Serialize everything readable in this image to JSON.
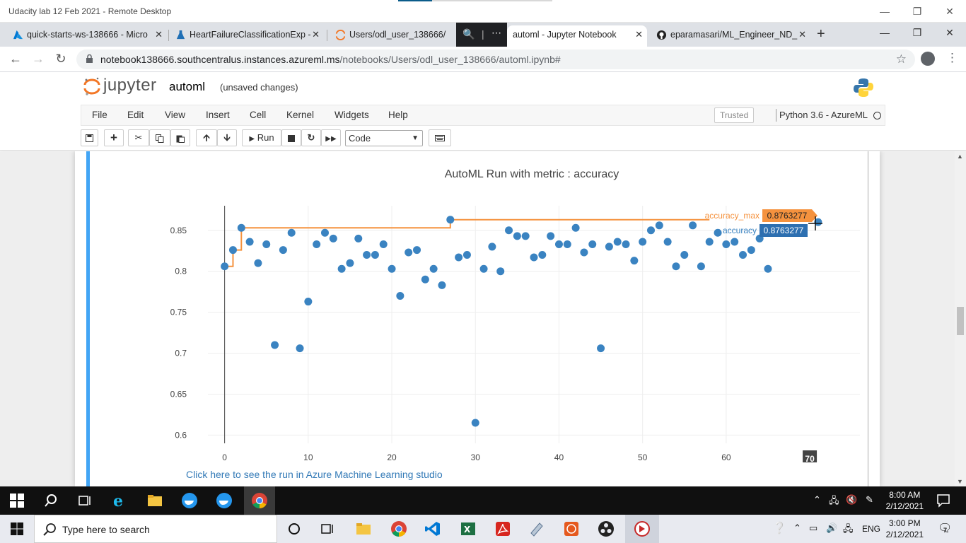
{
  "remote_window": {
    "title": "Udacity lab 12 Feb 2021 - Remote Desktop"
  },
  "browser": {
    "tabs": [
      {
        "label": "quick-starts-ws-138666 - Micro"
      },
      {
        "label": "HeartFailureClassificationExp -"
      },
      {
        "label": "Users/odl_user_138666/"
      },
      {
        "label": "automl - Jupyter Notebook"
      },
      {
        "label": "eparamasari/ML_Engineer_ND_"
      }
    ],
    "url_host": "notebook138666.southcentralus.instances.azureml.ms",
    "url_path": "/notebooks/Users/odl_user_138666/automl.ipynb#"
  },
  "jupyter": {
    "logo_text": "jupyter",
    "notebook_name": "automl",
    "save_status": "(unsaved changes)",
    "menu": [
      "File",
      "Edit",
      "View",
      "Insert",
      "Cell",
      "Kernel",
      "Widgets",
      "Help"
    ],
    "trusted": "Trusted",
    "kernel": "Python 3.6 - AzureML",
    "run_label": "Run",
    "cell_type": "Code",
    "link_text": "Click here to see the run in Azure Machine Learning studio"
  },
  "chart_data": {
    "type": "scatter",
    "title": "AutoML Run with metric : accuracy",
    "xlabel": "",
    "ylabel": "",
    "x_ticks": [
      0,
      10,
      20,
      30,
      40,
      50,
      60
    ],
    "y_ticks": [
      0.6,
      0.65,
      0.7,
      0.75,
      0.8,
      0.85
    ],
    "xlim": [
      -2,
      76
    ],
    "ylim": [
      0.59,
      0.88
    ],
    "grid": true,
    "series": [
      {
        "name": "accuracy",
        "color": "#3a83c1",
        "points": [
          [
            0,
            0.806
          ],
          [
            1,
            0.826
          ],
          [
            2,
            0.853
          ],
          [
            3,
            0.836
          ],
          [
            4,
            0.81
          ],
          [
            5,
            0.833
          ],
          [
            6,
            0.71
          ],
          [
            7,
            0.826
          ],
          [
            8,
            0.847
          ],
          [
            9,
            0.706
          ],
          [
            10,
            0.763
          ],
          [
            11,
            0.833
          ],
          [
            12,
            0.847
          ],
          [
            13,
            0.84
          ],
          [
            14,
            0.803
          ],
          [
            15,
            0.81
          ],
          [
            16,
            0.84
          ],
          [
            17,
            0.82
          ],
          [
            18,
            0.82
          ],
          [
            19,
            0.833
          ],
          [
            20,
            0.803
          ],
          [
            21,
            0.77
          ],
          [
            22,
            0.823
          ],
          [
            23,
            0.826
          ],
          [
            24,
            0.79
          ],
          [
            25,
            0.803
          ],
          [
            26,
            0.783
          ],
          [
            27,
            0.863
          ],
          [
            28,
            0.817
          ],
          [
            29,
            0.82
          ],
          [
            30,
            0.615
          ],
          [
            31,
            0.803
          ],
          [
            32,
            0.83
          ],
          [
            33,
            0.8
          ],
          [
            34,
            0.85
          ],
          [
            35,
            0.843
          ],
          [
            36,
            0.843
          ],
          [
            37,
            0.817
          ],
          [
            38,
            0.82
          ],
          [
            39,
            0.843
          ],
          [
            40,
            0.833
          ],
          [
            41,
            0.833
          ],
          [
            42,
            0.853
          ],
          [
            43,
            0.823
          ],
          [
            44,
            0.833
          ],
          [
            45,
            0.706
          ],
          [
            46,
            0.83
          ],
          [
            47,
            0.836
          ],
          [
            48,
            0.833
          ],
          [
            49,
            0.813
          ],
          [
            50,
            0.836
          ],
          [
            51,
            0.85
          ],
          [
            52,
            0.856
          ],
          [
            53,
            0.836
          ],
          [
            54,
            0.806
          ],
          [
            55,
            0.82
          ],
          [
            56,
            0.856
          ],
          [
            57,
            0.806
          ],
          [
            58,
            0.836
          ],
          [
            59,
            0.847
          ],
          [
            60,
            0.833
          ],
          [
            61,
            0.836
          ],
          [
            62,
            0.82
          ],
          [
            63,
            0.826
          ],
          [
            64,
            0.84
          ],
          [
            65,
            0.803
          ],
          [
            71,
            0.86
          ]
        ]
      },
      {
        "name": "accuracy_max",
        "color": "#f5923e",
        "steps": [
          [
            0,
            0.806
          ],
          [
            1,
            0.826
          ],
          [
            2,
            0.853
          ],
          [
            27,
            0.863
          ],
          [
            58,
            0.863
          ]
        ]
      }
    ],
    "hover": {
      "x_label": "70",
      "accuracy_max_label": "accuracy_max",
      "accuracy_max_value": "0.8763277",
      "accuracy_label": "accuracy",
      "accuracy_value": "0.8763277"
    }
  },
  "remote_taskbar": {
    "time": "8:00 AM",
    "date": "2/12/2021"
  },
  "local_taskbar": {
    "search_placeholder": "Type here to search",
    "language": "ENG",
    "time": "3:00 PM",
    "date": "2/12/2021",
    "notification_count": "7"
  }
}
